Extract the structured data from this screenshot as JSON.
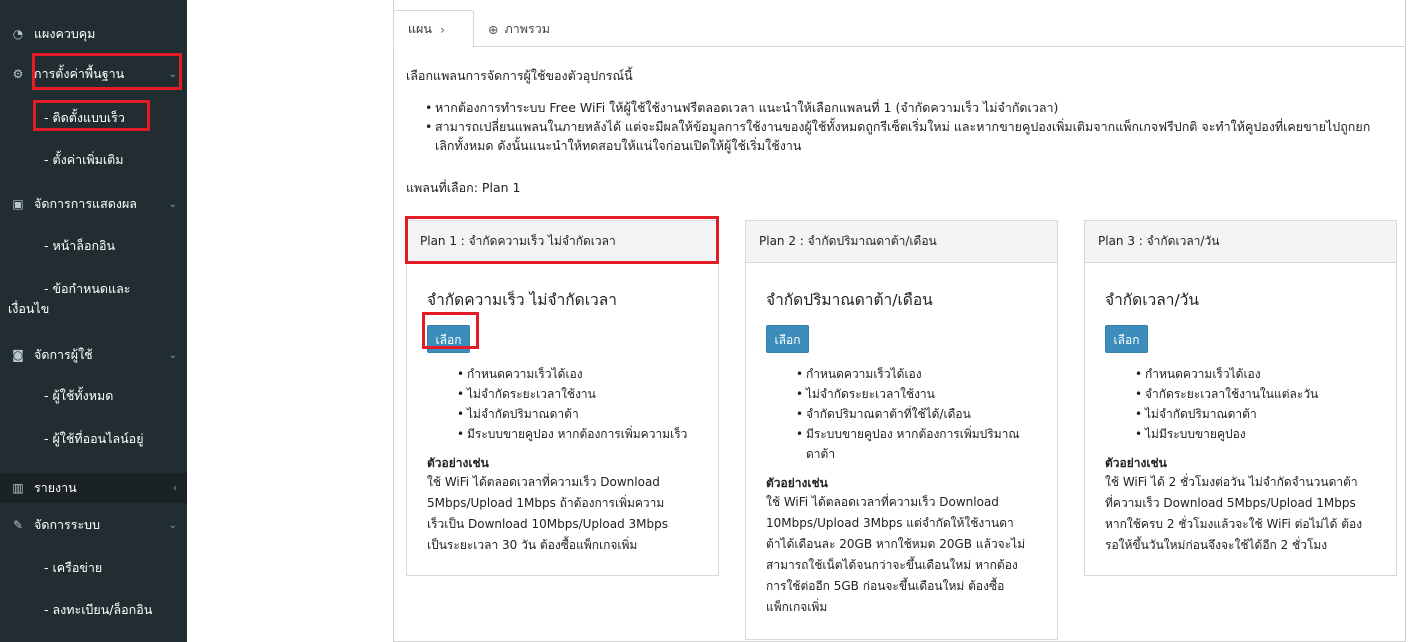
{
  "sidebar": {
    "items": [
      {
        "label": "แผงควบคุม",
        "icon": "dashboard-icon"
      },
      {
        "label": "การตั้งค่าพื้นฐาน",
        "icon": "gear-icon"
      },
      {
        "label": "- ติดตั้งแบบเร็ว"
      },
      {
        "label": "- ตั้งค่าเพิ่มเติม"
      },
      {
        "label": "จัดการการแสดงผล",
        "icon": "image-icon"
      },
      {
        "label": "- หน้าล็อกอิน"
      },
      {
        "label": "- ข้อกำหนดและ"
      },
      {
        "label": "เงื่อนไข"
      },
      {
        "label": "จัดการผู้ใช้",
        "icon": "user-card-icon"
      },
      {
        "label": "- ผู้ใช้ทั้งหมด"
      },
      {
        "label": "- ผู้ใช้ที่ออนไลน์อยู่"
      },
      {
        "label": "รายงาน",
        "icon": "bar-chart-icon"
      },
      {
        "label": "จัดการระบบ",
        "icon": "wrench-icon"
      },
      {
        "label": "- เครือข่าย"
      },
      {
        "label": "- ลงทะเบียน/ล็อกอิน"
      }
    ]
  },
  "tabs": {
    "plan": "แผน",
    "overview": "ภาพรวม"
  },
  "intro": "เลือกแพลนการจัดการผู้ใช้ของตัวอุปกรณ์นี้",
  "bullets": [
    "หากต้องการทำระบบ Free WiFi ให้ผู้ใช้ใช้งานฟรีตลอดเวลา แนะนำให้เลือกแพลนที่ 1 (จำกัดความเร็ว ไม่จำกัดเวลา)",
    "สามารถเปลี่ยนแพลนในภายหลังได้ แต่จะมีผลให้ข้อมูลการใช้งานของผู้ใช้ทั้งหมดถูกรีเซ็ตเริ่มใหม่ และหากขายคูปองเพิ่มเติมจากแพ็กเกจฟรีปกติ จะทำให้คูปองที่เคยขายไปถูกยก",
    "เลิกทั้งหมด ดังนั้นแนะนำให้ทดสอบให้แน่ใจก่อนเปิดให้ผู้ใช้เริ่มใช้งาน"
  ],
  "selected": "แพลนที่เลือก: Plan 1",
  "plans": [
    {
      "header": "Plan 1 : จำกัดความเร็ว ไม่จำกัดเวลา",
      "title": "จำกัดความเร็ว ไม่จำกัดเวลา",
      "button": "เลือก",
      "features": [
        "กำหนดความเร็วได้เอง",
        "ไม่จำกัดระยะเวลาใช้งาน",
        "ไม่จำกัดปริมาณดาต้า",
        "มีระบบขายคูปอง หากต้องการเพิ่มความเร็ว"
      ],
      "example_title": "ตัวอย่างเช่น",
      "example_lines": [
        "ใช้ WiFi ได้ตลอดเวลาที่ความเร็ว Download",
        "5Mbps/Upload 1Mbps ถ้าต้องการเพิ่มความ",
        "เร็วเป็น Download 10Mbps/Upload 3Mbps",
        "เป็นระยะเวลา 30 วัน ต้องซื้อแพ็กเกจเพิ่ม"
      ]
    },
    {
      "header": "Plan 2 : จำกัดปริมาณดาต้า/เดือน",
      "title": "จำกัดปริมาณดาต้า/เดือน",
      "button": "เลือก",
      "features": [
        "กำหนดความเร็วได้เอง",
        "ไม่จำกัดระยะเวลาใช้งาน",
        "จำกัดปริมาณดาต้าที่ใช้ได้/เดือน",
        "มีระบบขายคูปอง หากต้องการเพิ่มปริมาณ",
        "ดาต้า"
      ],
      "example_title": "ตัวอย่างเช่น",
      "example_lines": [
        "ใช้ WiFi ได้ตลอดเวลาที่ความเร็ว Download",
        "10Mbps/Upload 3Mbps แต่จำกัดให้ใช้งานดา",
        "ต้าได้เดือนละ 20GB หากใช้หมด 20GB แล้วจะไม่",
        "สามารถใช้เน็ตได้จนกว่าจะขึ้นเดือนใหม่ หากต้อง",
        "การใช้ต่ออีก 5GB ก่อนจะขึ้นเดือนใหม่ ต้องซื้อ",
        "แพ็กเกจเพิ่ม"
      ]
    },
    {
      "header": "Plan 3 : จำกัดเวลา/วัน",
      "title": "จำกัดเวลา/วัน",
      "button": "เลือก",
      "features": [
        "กำหนดความเร็วได้เอง",
        "จำกัดระยะเวลาใช้งานในแต่ละวัน",
        "ไม่จำกัดปริมาณดาต้า",
        "ไม่มีระบบขายคูปอง"
      ],
      "example_title": "ตัวอย่างเช่น",
      "example_lines": [
        "ใช้ WiFi ได้ 2 ชั่วโมงต่อวัน ไม่จำกัดจำนวนดาต้า",
        "ที่ความเร็ว Download 5Mbps/Upload 1Mbps",
        "หากใช้ครบ 2 ชั่วโมงแล้วจะใช้ WiFi ต่อไม่ได้ ต้อง",
        "รอให้ขึ้นวันใหม่ก่อนจึงจะใช้ได้อีก 2 ชั่วโมง"
      ]
    }
  ]
}
